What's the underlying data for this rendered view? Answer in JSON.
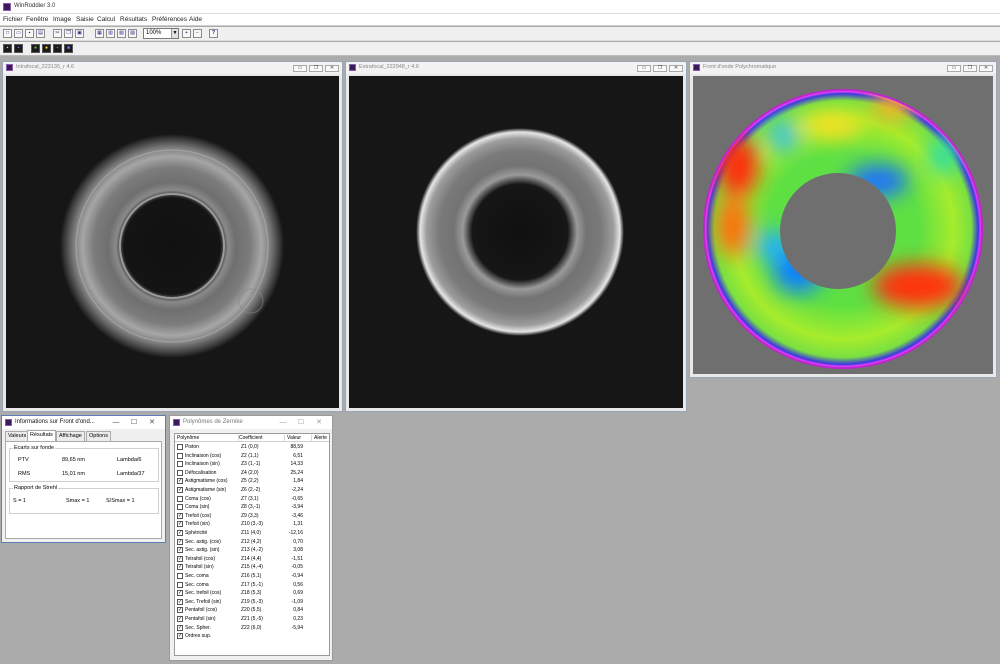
{
  "app": {
    "title": "WinRoddier 3.0"
  },
  "menu": [
    "Fichier",
    "Fenêtre",
    "Image",
    "Saisie",
    "Calcul",
    "Résultats",
    "Préférences",
    "Aide"
  ],
  "toolbar": {
    "zoom_value": "100%",
    "help": "?"
  },
  "windows": {
    "intra": {
      "title": "Intrafocal_223135_r 4.6"
    },
    "extra": {
      "title": "Extrafocal_222948_r 4.6"
    },
    "wavefront": {
      "title": "Front d'onde Polychromatique"
    }
  },
  "info": {
    "title": "Informations sur Front d'ond...",
    "tabs": [
      "Valeurs",
      "Résultats",
      "Affichage",
      "Options"
    ],
    "ecarts_title": "Ecarts sur fonde",
    "ptv_label": "PTV",
    "ptv_value": "89,65 nm",
    "ptv_lambda": "Lambda/6",
    "rms_label": "RMS",
    "rms_value": "15,01 nm",
    "rms_lambda": "Lambda/37",
    "strehl_title": "Rapport de Strehl",
    "s": "S = 1",
    "smax": "Smax = 1",
    "ssmax": "S/Smax = 1"
  },
  "zernike": {
    "title": "Polynômes de Zernike",
    "headers": [
      "Polynôme",
      "Coefficient",
      "Valeur",
      "Alerte"
    ],
    "rows": [
      {
        "name": "Piston",
        "coef": "Z1 (0,0)",
        "value": "88,59",
        "checked": false
      },
      {
        "name": "Inclinaison (cos)",
        "coef": "Z2 (1,1)",
        "value": "6,51",
        "checked": false
      },
      {
        "name": "Inclinaison (sin)",
        "coef": "Z3 (1,-1)",
        "value": "14,33",
        "checked": false
      },
      {
        "name": "Défocalisation",
        "coef": "Z4 (2,0)",
        "value": "25,24",
        "checked": false
      },
      {
        "name": "Astigmatisme (cos)",
        "coef": "Z5 (2,2)",
        "value": "1,84",
        "checked": true
      },
      {
        "name": "Astigmatisme (sin)",
        "coef": "Z6 (2,-2)",
        "value": "-2,24",
        "checked": true
      },
      {
        "name": "Coma (cos)",
        "coef": "Z7 (3,1)",
        "value": "-0,65",
        "checked": false
      },
      {
        "name": "Coma (sin)",
        "coef": "Z8 (3,-1)",
        "value": "-3,94",
        "checked": false
      },
      {
        "name": "Trefoil (cos)",
        "coef": "Z9 (3,3)",
        "value": "-3,46",
        "checked": true
      },
      {
        "name": "Trefoil (sin)",
        "coef": "Z10 (3,-3)",
        "value": "1,31",
        "checked": true
      },
      {
        "name": "Sphéricité",
        "coef": "Z11 (4,0)",
        "value": "-12,16",
        "checked": true
      },
      {
        "name": "Sec. astig. (cos)",
        "coef": "Z12 (4,2)",
        "value": "0,70",
        "checked": true
      },
      {
        "name": "Sec. astig. (sin)",
        "coef": "Z13 (4,-2)",
        "value": "3,08",
        "checked": true
      },
      {
        "name": "Tetrafoil (cos)",
        "coef": "Z14 (4,4)",
        "value": "-1,51",
        "checked": true
      },
      {
        "name": "Tetrafoil (sin)",
        "coef": "Z15 (4,-4)",
        "value": "-0,05",
        "checked": true
      },
      {
        "name": "Sec. coma",
        "coef": "Z16 (5,1)",
        "value": "-0,94",
        "checked": false
      },
      {
        "name": "Sec. coma",
        "coef": "Z17 (5,-1)",
        "value": "0,56",
        "checked": false
      },
      {
        "name": "Sec. trefoil (cos)",
        "coef": "Z18 (5,3)",
        "value": "0,69",
        "checked": true
      },
      {
        "name": "Sec. Trefoil (sin)",
        "coef": "Z19 (5,-3)",
        "value": "-1,09",
        "checked": true
      },
      {
        "name": "Pentafoil (cos)",
        "coef": "Z20 (5,5)",
        "value": "0,84",
        "checked": true
      },
      {
        "name": "Pentafoil (sin)",
        "coef": "Z21 (5,-5)",
        "value": "0,23",
        "checked": true
      },
      {
        "name": "Sec. Spher.",
        "coef": "Z22 (6,0)",
        "value": "-5,94",
        "checked": true
      },
      {
        "name": "Ordres sup.",
        "coef": "",
        "value": "",
        "checked": true
      }
    ]
  }
}
